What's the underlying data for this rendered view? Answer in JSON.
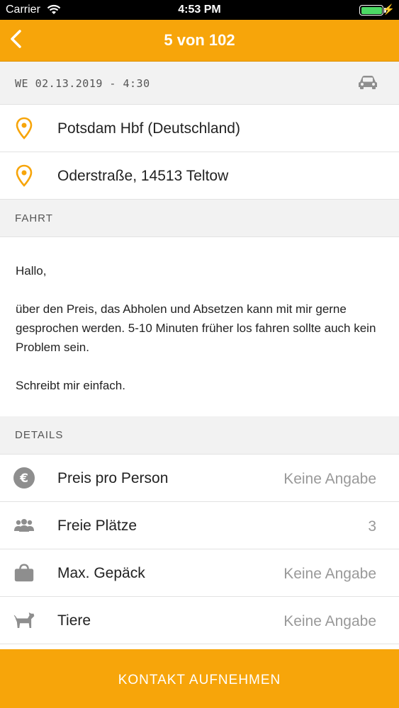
{
  "status": {
    "carrier": "Carrier",
    "time": "4:53 PM",
    "battery_level": 1.0
  },
  "nav": {
    "title": "5 von 102"
  },
  "ride": {
    "datetime": "WE 02.13.2019 - 4:30",
    "from": "Potsdam Hbf (Deutschland)",
    "to": "Oderstraße, 14513 Teltow"
  },
  "sections": {
    "ride": "FAHRT",
    "details": "DETAILS"
  },
  "message": {
    "greeting": "Hallo,",
    "body": "über den Preis, das Abholen und Absetzen kann mit mir gerne gesprochen werden. 5-10 Minuten früher los fahren sollte auch kein Problem sein.",
    "closing": "Schreibt mir einfach."
  },
  "details": [
    {
      "label": "Preis pro Person",
      "value": "Keine Angabe",
      "icon": "euro-icon"
    },
    {
      "label": "Freie Plätze",
      "value": "3",
      "icon": "people-icon"
    },
    {
      "label": "Max. Gepäck",
      "value": "Keine Angabe",
      "icon": "bag-icon"
    },
    {
      "label": "Tiere",
      "value": "Keine Angabe",
      "icon": "dog-icon"
    }
  ],
  "footer": {
    "contact_label": "KONTAKT AUFNEHMEN"
  },
  "colors": {
    "accent": "#f7a50a",
    "section_bg": "#f2f2f2",
    "icon_gray": "#8e8e8e"
  }
}
